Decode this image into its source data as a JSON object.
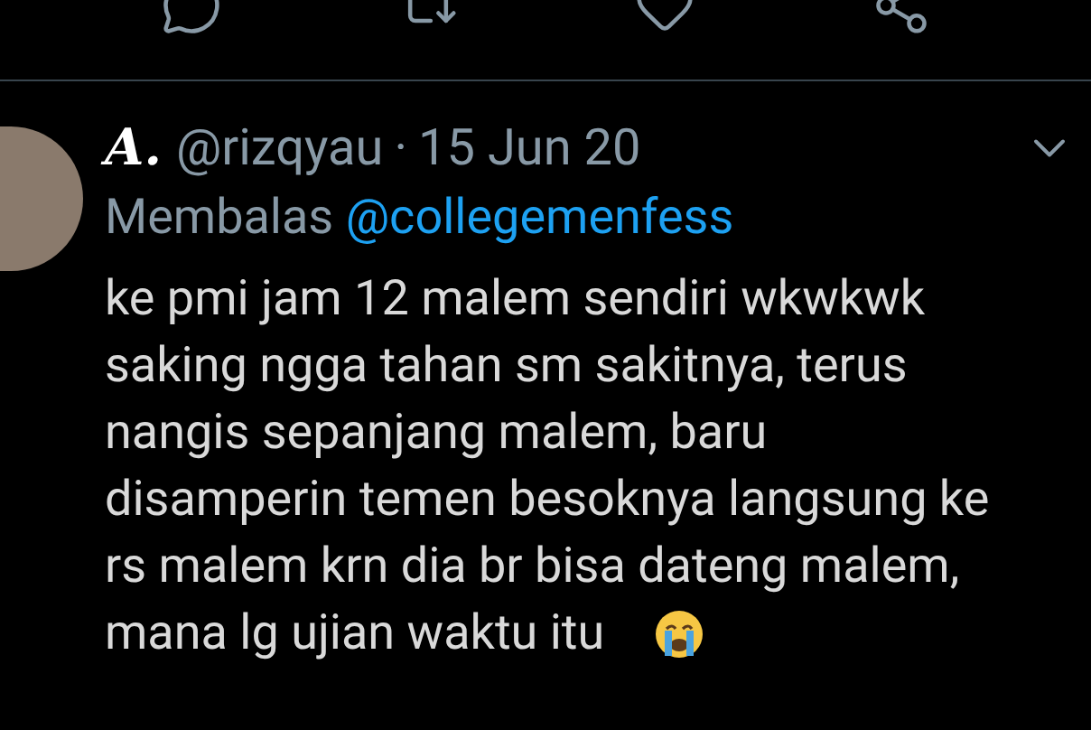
{
  "tweet": {
    "display_name": "A.",
    "handle": "@rizqyau",
    "separator": "·",
    "date": "15 Jun 20",
    "reply_prefix": "Membalas",
    "reply_to": "@collegemenfess",
    "body_lines": [
      "ke pmi jam 12 malem sendiri wkwkwk",
      "saking ngga tahan sm sakitnya, terus",
      "nangis sepanjang malem, baru",
      "disamperin temen besoknya langsung ke",
      "rs malem krn dia br bisa dateng malem,",
      "mana lg ujian waktu itu"
    ]
  }
}
